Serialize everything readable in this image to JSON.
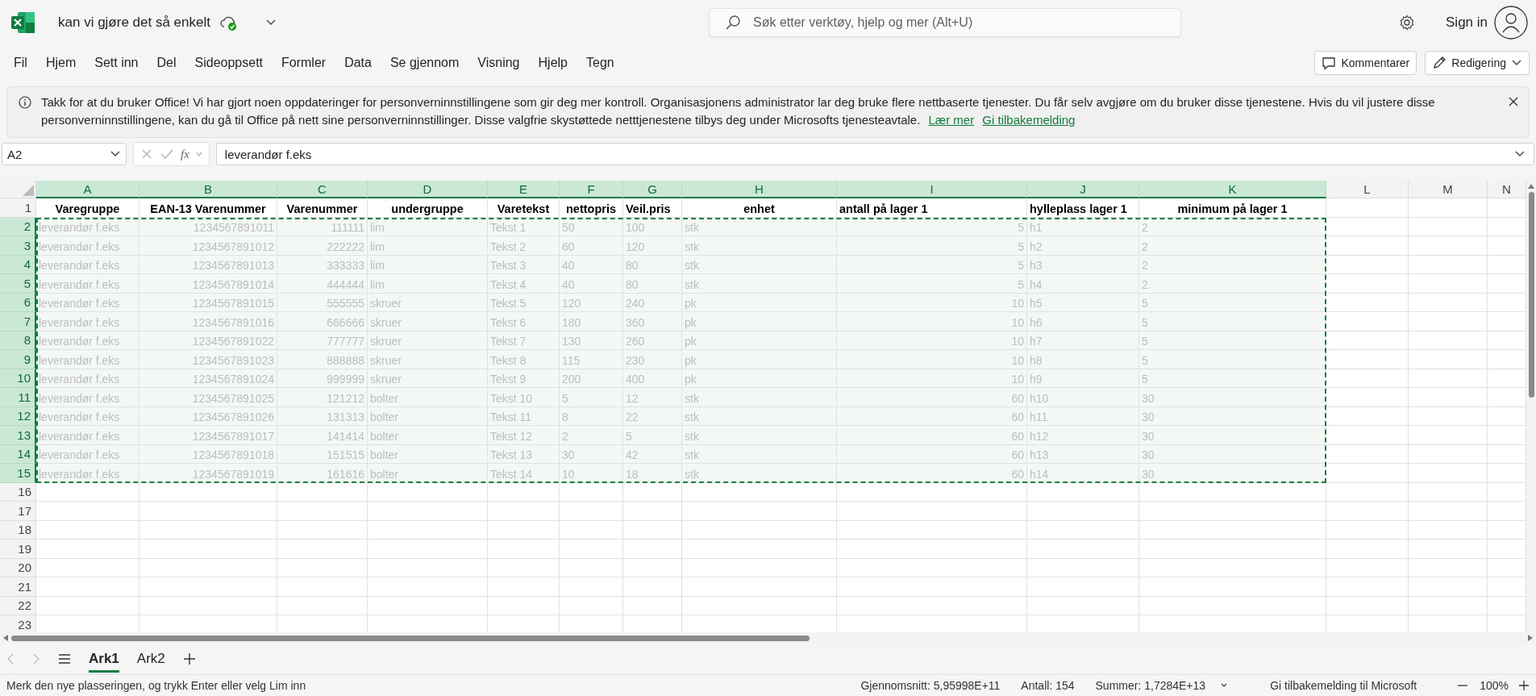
{
  "app": {
    "title": "kan vi gjøre det så enkelt",
    "search": {
      "placeholder": "Søk etter verktøy, hjelp og mer (Alt+U)"
    },
    "sign_in": "Sign in"
  },
  "menu": [
    "Fil",
    "Hjem",
    "Sett inn",
    "Del",
    "Sideoppsett",
    "Formler",
    "Data",
    "Se gjennom",
    "Visning",
    "Hjelp",
    "Tegn"
  ],
  "actions": [
    {
      "kind": "comment",
      "label": "Kommentarer"
    },
    {
      "kind": "edit",
      "label": "Redigering"
    }
  ],
  "banner": {
    "text": "Takk for at du bruker Office! Vi har gjort noen oppdateringer for personverninnstillingene som gir deg mer kontroll. Organisasjonens administrator lar deg bruke flere nettbaserte tjenester. Du får selv avgjøre om du bruker disse tjenestene. Hvis du vil justere disse personverninnstillingene, kan du gå til Office på nett sine personverninnstillinger. Disse valgfrie skystøttede netttjenestene tilbys deg under Microsofts tjenesteavtale.",
    "links": [
      "Lær mer",
      "Gi tilbakemelding"
    ]
  },
  "formula_bar": {
    "name_box": "A2",
    "function_label": "fx",
    "formula": "leverandør f.eks"
  },
  "grid": {
    "columns": [
      {
        "letter": "A",
        "selected": true
      },
      {
        "letter": "B",
        "selected": true
      },
      {
        "letter": "C",
        "selected": true
      },
      {
        "letter": "D",
        "selected": true
      },
      {
        "letter": "E",
        "selected": true
      },
      {
        "letter": "F",
        "selected": true
      },
      {
        "letter": "G",
        "selected": true
      },
      {
        "letter": "H",
        "selected": true
      },
      {
        "letter": "I",
        "selected": true
      },
      {
        "letter": "J",
        "selected": true
      },
      {
        "letter": "K",
        "selected": true
      },
      {
        "letter": "L",
        "selected": false
      },
      {
        "letter": "M",
        "selected": false
      },
      {
        "letter": "N",
        "selected": false
      }
    ],
    "rows": [
      {
        "number": "1",
        "kind": "header",
        "selected": false,
        "cells": [
          "Varegruppe",
          "EAN-13 Varenummer",
          "Varenummer",
          "undergruppe",
          "Varetekst",
          "nettopris",
          "Veil.pris",
          "enhet",
          "antall på lager 1",
          "hylleplass lager 1",
          "minimum på lager 1"
        ]
      },
      {
        "number": "2",
        "kind": "data",
        "selected": true,
        "cells": [
          "leverandør f.eks",
          "1234567891011",
          "111111",
          "lim",
          "Tekst 1",
          "50",
          "100",
          "stk",
          "5",
          "h1",
          "2"
        ]
      },
      {
        "number": "3",
        "kind": "data",
        "selected": true,
        "cells": [
          "leverandør f.eks",
          "1234567891012",
          "222222",
          "lim",
          "Tekst 2",
          "60",
          "120",
          "stk",
          "5",
          "h2",
          "2"
        ]
      },
      {
        "number": "4",
        "kind": "data",
        "selected": true,
        "cells": [
          "leverandør f.eks",
          "1234567891013",
          "333333",
          "lim",
          "Tekst 3",
          "40",
          "80",
          "stk",
          "5",
          "h3",
          "2"
        ]
      },
      {
        "number": "5",
        "kind": "data",
        "selected": true,
        "cells": [
          "leverandør f.eks",
          "1234567891014",
          "444444",
          "lim",
          "Tekst 4",
          "40",
          "80",
          "stk",
          "5",
          "h4",
          "2"
        ]
      },
      {
        "number": "6",
        "kind": "data",
        "selected": true,
        "cells": [
          "leverandør f.eks",
          "1234567891015",
          "555555",
          "skruer",
          "Tekst 5",
          "120",
          "240",
          "pk",
          "10",
          "h5",
          "5"
        ]
      },
      {
        "number": "7",
        "kind": "data",
        "selected": true,
        "cells": [
          "leverandør f.eks",
          "1234567891016",
          "666666",
          "skruer",
          "Tekst 6",
          "180",
          "360",
          "pk",
          "10",
          "h6",
          "5"
        ]
      },
      {
        "number": "8",
        "kind": "data",
        "selected": true,
        "cells": [
          "leverandør f.eks",
          "1234567891022",
          "777777",
          "skruer",
          "Tekst 7",
          "130",
          "260",
          "pk",
          "10",
          "h7",
          "5"
        ]
      },
      {
        "number": "9",
        "kind": "data",
        "selected": true,
        "cells": [
          "leverandør f.eks",
          "1234567891023",
          "888888",
          "skruer",
          "Tekst 8",
          "115",
          "230",
          "pk",
          "10",
          "h8",
          "5"
        ]
      },
      {
        "number": "10",
        "kind": "data",
        "selected": true,
        "cells": [
          "leverandør f.eks",
          "1234567891024",
          "999999",
          "skruer",
          "Tekst 9",
          "200",
          "400",
          "pk",
          "10",
          "h9",
          "5"
        ]
      },
      {
        "number": "11",
        "kind": "data",
        "selected": true,
        "cells": [
          "leverandør f.eks",
          "1234567891025",
          "121212",
          "bolter",
          "Tekst 10",
          "5",
          "12",
          "stk",
          "60",
          "h10",
          "30"
        ]
      },
      {
        "number": "12",
        "kind": "data",
        "selected": true,
        "cells": [
          "leverandør f.eks",
          "1234567891026",
          "131313",
          "bolter",
          "Tekst 11",
          "8",
          "22",
          "stk",
          "60",
          "h11",
          "30"
        ]
      },
      {
        "number": "13",
        "kind": "data",
        "selected": true,
        "cells": [
          "leverandør f.eks",
          "1234567891017",
          "141414",
          "bolter",
          "Tekst 12",
          "2",
          "5",
          "stk",
          "60",
          "h12",
          "30"
        ]
      },
      {
        "number": "14",
        "kind": "data",
        "selected": true,
        "cells": [
          "leverandør f.eks",
          "1234567891018",
          "151515",
          "bolter",
          "Tekst 13",
          "30",
          "42",
          "stk",
          "60",
          "h13",
          "30"
        ]
      },
      {
        "number": "15",
        "kind": "data",
        "selected": true,
        "cells": [
          "leverandør f.eks",
          "1234567891019",
          "161616",
          "bolter",
          "Tekst 14",
          "10",
          "18",
          "stk",
          "60",
          "h14",
          "30"
        ]
      },
      {
        "number": "16",
        "kind": "data",
        "selected": false
      },
      {
        "number": "17",
        "kind": "data",
        "selected": false
      },
      {
        "number": "18",
        "kind": "data",
        "selected": false
      },
      {
        "number": "19",
        "kind": "data",
        "selected": false
      },
      {
        "number": "20",
        "kind": "data",
        "selected": false
      },
      {
        "number": "21",
        "kind": "data",
        "selected": false
      },
      {
        "number": "22",
        "kind": "data",
        "selected": false
      },
      {
        "number": "23",
        "kind": "data",
        "selected": false
      }
    ]
  },
  "sheet_tabs": [
    {
      "label": "Ark1",
      "selected": true
    },
    {
      "label": "Ark2",
      "selected": false
    }
  ],
  "status_bar": {
    "message": "Merk den nye plasseringen, og trykk Enter eller velg Lim inn",
    "average": "Gjennomsnitt: 5,95998E+11",
    "count": "Antall: 154",
    "sum": "Summer: 1,7284E+13",
    "feedback": "Gi tilbakemelding til Microsoft",
    "zoom": "100%"
  }
}
